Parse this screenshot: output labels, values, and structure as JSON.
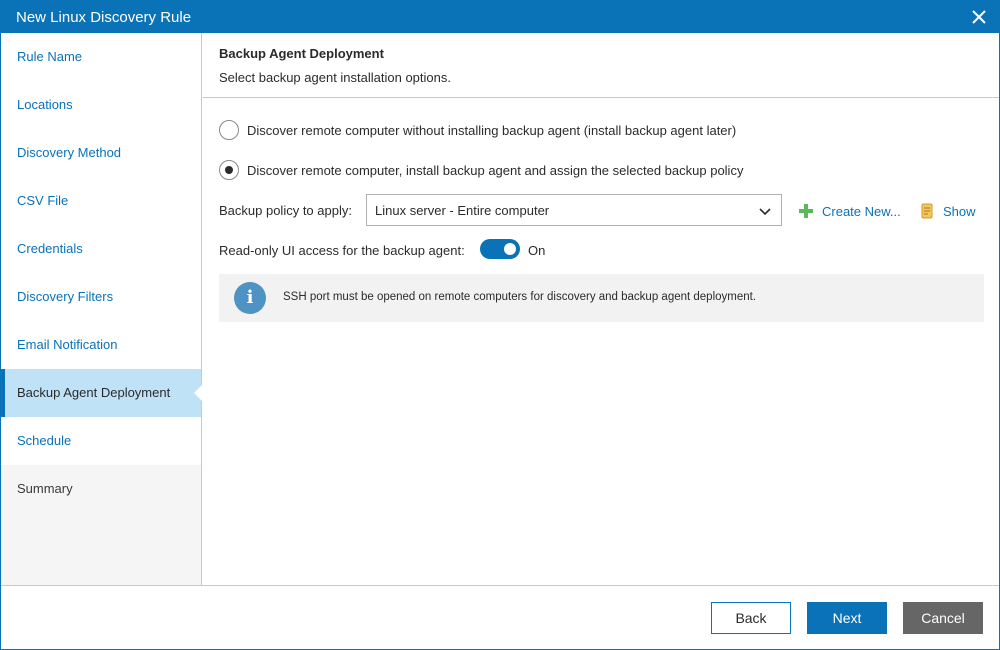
{
  "window": {
    "title": "New Linux Discovery Rule",
    "close_icon": "close-icon"
  },
  "sidebar": {
    "items": [
      {
        "label": "Rule Name",
        "state": "link"
      },
      {
        "label": "Locations",
        "state": "link"
      },
      {
        "label": "Discovery Method",
        "state": "link"
      },
      {
        "label": "CSV File",
        "state": "link"
      },
      {
        "label": "Credentials",
        "state": "link"
      },
      {
        "label": "Discovery Filters",
        "state": "link"
      },
      {
        "label": "Email Notification",
        "state": "link"
      },
      {
        "label": "Backup Agent Deployment",
        "state": "active"
      },
      {
        "label": "Schedule",
        "state": "link"
      },
      {
        "label": "Summary",
        "state": "disabled"
      }
    ]
  },
  "page": {
    "title": "Backup Agent Deployment",
    "subtitle": "Select backup agent installation options."
  },
  "options": {
    "radio1": {
      "label": "Discover remote computer without installing backup agent (install backup agent later)",
      "checked": false
    },
    "radio2": {
      "label": "Discover remote computer, install backup agent and assign the selected backup policy",
      "checked": true
    }
  },
  "policy": {
    "label": "Backup policy to apply:",
    "selected": "Linux server - Entire computer",
    "create_new": "Create New...",
    "show": "Show"
  },
  "readonly": {
    "label": "Read-only UI access for the backup agent:",
    "enabled": true,
    "state_text": "On"
  },
  "info": {
    "icon": "i",
    "text": "SSH port must be opened on remote computers for discovery and backup agent deployment."
  },
  "footer": {
    "back": "Back",
    "next": "Next",
    "cancel": "Cancel"
  },
  "colors": {
    "accent": "#0a72b6",
    "active_nav": "#bfe2f7",
    "create_icon": "#5cb85c",
    "show_icon": "#e2a53a",
    "cancel": "#666666"
  }
}
